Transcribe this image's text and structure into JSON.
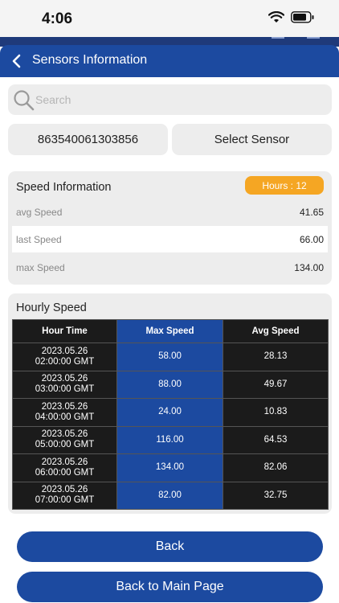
{
  "status": {
    "time": "4:06"
  },
  "header": {
    "title": "Sensors Information"
  },
  "search": {
    "placeholder": "Search"
  },
  "sensor": {
    "id": "863540061303856",
    "select_label": "Select Sensor"
  },
  "speed_info": {
    "title": "Speed Information",
    "hours_badge": "Hours : 12",
    "rows": [
      {
        "label": "avg Speed",
        "value": "41.65"
      },
      {
        "label": "last Speed",
        "value": "66.00"
      },
      {
        "label": "max Speed",
        "value": "134.00"
      }
    ]
  },
  "hourly": {
    "title": "Hourly Speed",
    "columns": [
      "Hour Time",
      "Max Speed",
      "Avg Speed"
    ],
    "rows": [
      {
        "date": "2023.05.26",
        "time": "02:00:00 GMT",
        "max": "58.00",
        "avg": "28.13"
      },
      {
        "date": "2023.05.26",
        "time": "03:00:00 GMT",
        "max": "88.00",
        "avg": "49.67"
      },
      {
        "date": "2023.05.26",
        "time": "04:00:00 GMT",
        "max": "24.00",
        "avg": "10.83"
      },
      {
        "date": "2023.05.26",
        "time": "05:00:00 GMT",
        "max": "116.00",
        "avg": "64.53"
      },
      {
        "date": "2023.05.26",
        "time": "06:00:00 GMT",
        "max": "134.00",
        "avg": "82.06"
      },
      {
        "date": "2023.05.26",
        "time": "07:00:00 GMT",
        "max": "82.00",
        "avg": "32.75"
      }
    ]
  },
  "buttons": {
    "back": "Back",
    "main_page": "Back to Main Page"
  },
  "colors": {
    "primary": "#1c4aa0",
    "badge": "#f5a623",
    "table_dark": "#1b1b1b",
    "card_bg": "#ededed"
  },
  "icons": [
    "wifi-icon",
    "battery-icon",
    "chevron-left-icon",
    "search-icon"
  ]
}
